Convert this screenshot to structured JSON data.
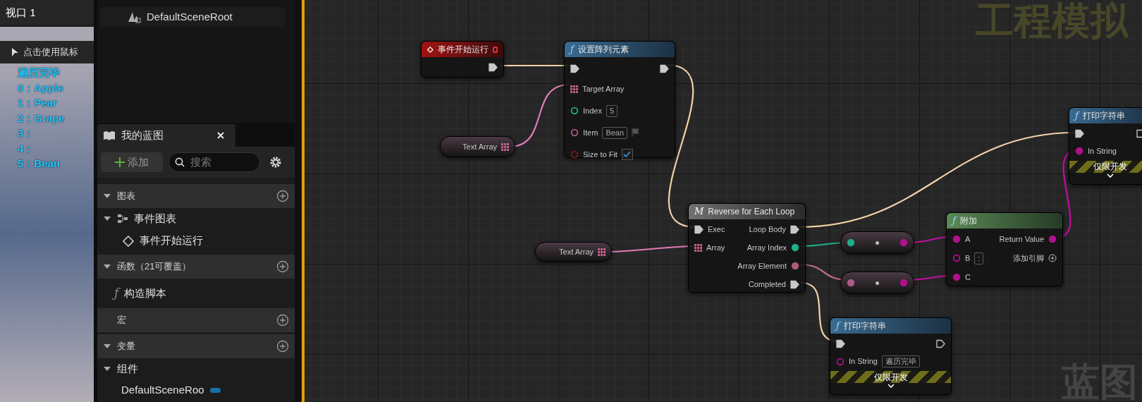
{
  "viewport": {
    "tab": "视口 1",
    "hint": "点击使用鼠标",
    "log": [
      "遍历完毕",
      "0：Apple",
      "1：Pear",
      "2：Grape",
      "3：",
      "4：",
      "5：Bean"
    ]
  },
  "components": {
    "rows": [
      "DefaultSceneRoot"
    ]
  },
  "my_blueprint": {
    "title": "我的蓝图",
    "add": "添加",
    "search_placeholder": "搜索",
    "rows": [
      {
        "kind": "section",
        "label": "图表",
        "expanded": true
      },
      {
        "kind": "tree",
        "label": "事件图表",
        "expanded": true
      },
      {
        "kind": "event",
        "label": "事件开始运行"
      },
      {
        "kind": "section",
        "label": "函数（21可覆盖）",
        "expanded": true
      },
      {
        "kind": "function",
        "label": "构造脚本",
        "icon": "ƒ"
      },
      {
        "kind": "section_plain",
        "label": "宏"
      },
      {
        "kind": "section",
        "label": "变量",
        "expanded": true
      },
      {
        "kind": "tree",
        "label": "组件",
        "expanded": true
      },
      {
        "kind": "variable",
        "label": "DefaultSceneRoo"
      }
    ]
  },
  "graph": {
    "watermarks": [
      "工程模拟",
      "蓝图"
    ],
    "nodes": [
      {
        "kind": "event",
        "title": "事件开始运行"
      },
      {
        "kind": "function",
        "icon": "ƒ",
        "title": "设置阵列元素",
        "pins": [
          {
            "kind": "array",
            "label": "Target Array"
          },
          {
            "kind": "int",
            "label": "Index",
            "value": "5"
          },
          {
            "kind": "string",
            "label": "Item",
            "value": "Bean"
          },
          {
            "kind": "bool",
            "label": "Size to Fit",
            "checked": true
          }
        ]
      },
      {
        "kind": "getter",
        "label": "Text Array"
      },
      {
        "kind": "macro",
        "icon": "M",
        "title": "Reverse for Each Loop",
        "inputs": [
          "Exec",
          "Array"
        ],
        "outputs": [
          "Loop Body",
          "Array Index",
          "Array Element",
          "Completed"
        ]
      },
      {
        "kind": "getter",
        "label": "Text Array"
      },
      {
        "kind": "convert"
      },
      {
        "kind": "convert"
      },
      {
        "kind": "append",
        "icon": "ƒ",
        "title": "附加",
        "inputs": [
          {
            "label": "A"
          },
          {
            "label": "B",
            "value": ":"
          },
          {
            "label": "C"
          }
        ],
        "output": "Return Value",
        "add_pin": "添加引脚"
      },
      {
        "kind": "print",
        "icon": "ƒ",
        "title": "打印字符串",
        "in_label": "In String",
        "dev": "仅限开发"
      },
      {
        "kind": "print",
        "icon": "ƒ",
        "title": "打印字符串",
        "in_label": "In String",
        "value": "遍历完毕",
        "dev": "仅限开发"
      }
    ]
  }
}
